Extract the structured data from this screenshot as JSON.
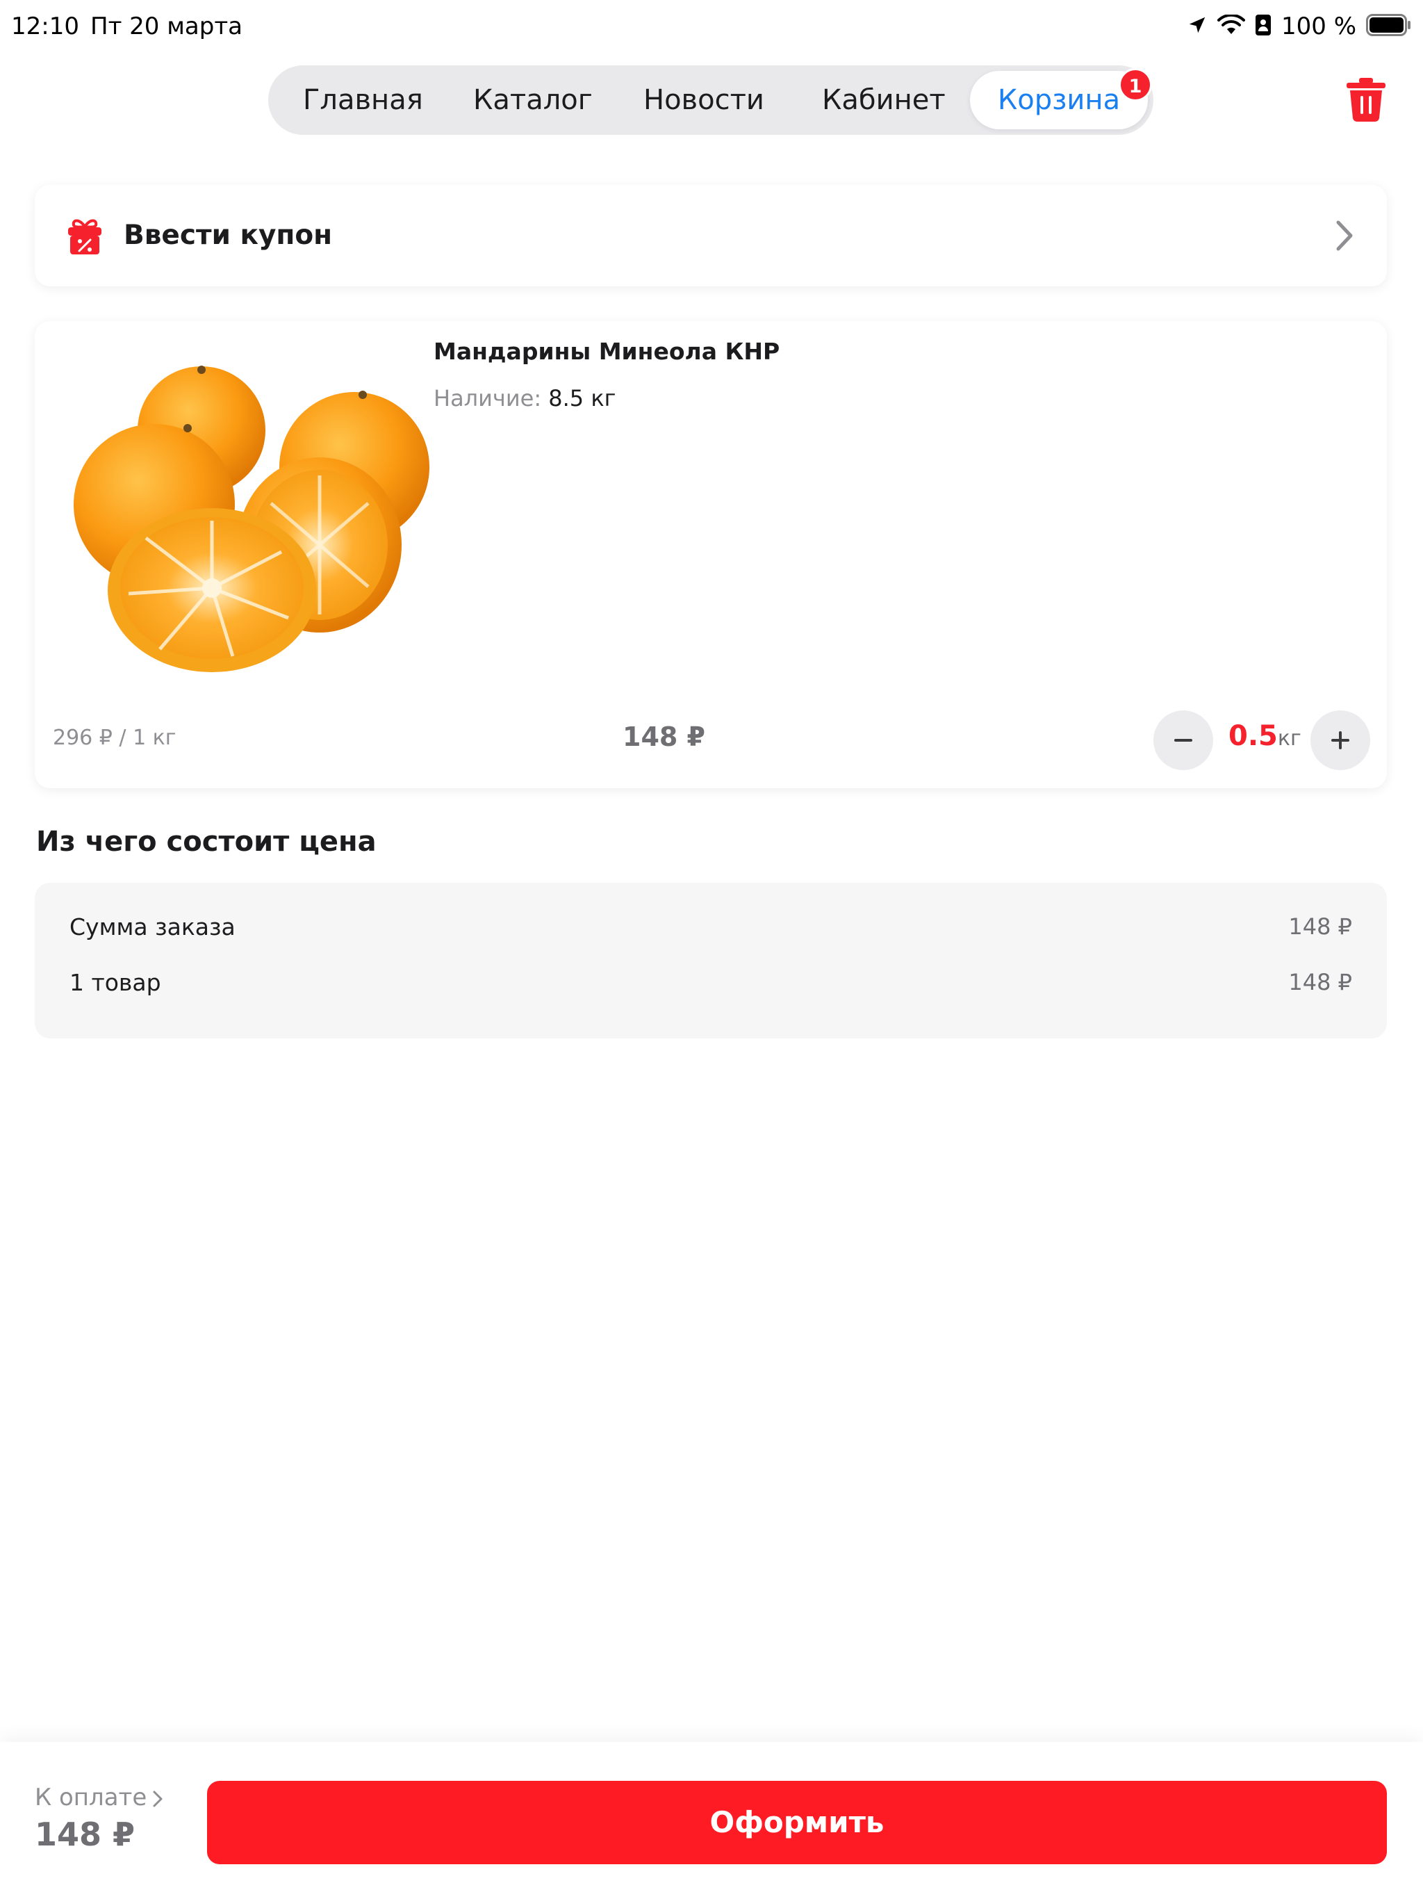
{
  "status_bar": {
    "time": "12:10",
    "date": "Пт 20 марта",
    "battery": "100 %"
  },
  "nav": {
    "tabs": [
      {
        "label": "Главная"
      },
      {
        "label": "Каталог"
      },
      {
        "label": "Новости"
      },
      {
        "label": "Кабинет"
      },
      {
        "label": "Корзина",
        "active": true
      }
    ],
    "cart_badge": "1"
  },
  "coupon": {
    "label": "Ввести купон"
  },
  "cart_item": {
    "name": "Мандарины Минеола КНР",
    "stock_label": "Наличие:",
    "stock_value": "8.5 кг",
    "unit_price": "296 ₽ / 1 кг",
    "total": "148 ₽",
    "quantity": "0.5",
    "quantity_unit": "кг"
  },
  "breakdown": {
    "title": "Из чего состоит цена",
    "rows": [
      {
        "label": "Сумма заказа",
        "value": "148 ₽"
      },
      {
        "label": "1 товар",
        "value": "148 ₽"
      }
    ]
  },
  "footer": {
    "pay_label": "К оплате",
    "pay_amount": "148 ₽",
    "checkout_label": "Оформить"
  },
  "colors": {
    "accent_blue": "#1a7ff0",
    "brand_red": "#ff1b24",
    "badge_red": "#f5222d"
  }
}
